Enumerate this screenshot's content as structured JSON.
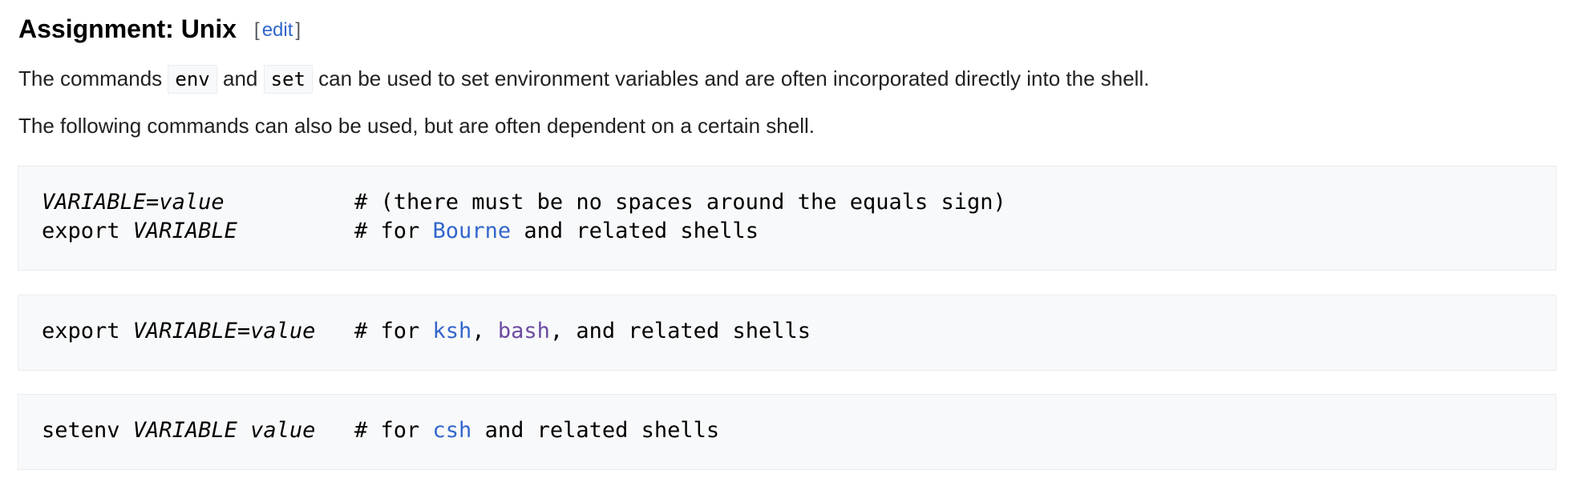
{
  "section": {
    "title": "Assignment: Unix",
    "edit_open": "[",
    "edit_label": "edit",
    "edit_close": "]"
  },
  "paragraph1": {
    "t1": "The commands ",
    "code1": "env",
    "t2": " and ",
    "code2": "set",
    "t3": " can be used to set environment variables and are often incorporated directly into the shell."
  },
  "paragraph2": {
    "text": "The following commands can also be used, but are often dependent on a certain shell."
  },
  "code_blocks": [
    {
      "lines": [
        {
          "cmd": [
            {
              "text": "VARIABLE",
              "italic": true
            },
            {
              "text": "=",
              "italic": false
            },
            {
              "text": "value",
              "italic": true
            }
          ],
          "comment": "# (there must be no spaces around the equals sign)"
        },
        {
          "cmd": [
            {
              "text": "export ",
              "italic": false
            },
            {
              "text": "VARIABLE",
              "italic": true
            }
          ],
          "comment_prefix": "# for ",
          "link": "Bourne",
          "comment_suffix": " and related shells"
        }
      ]
    },
    {
      "lines": [
        {
          "cmd": [
            {
              "text": "export ",
              "italic": false
            },
            {
              "text": "VARIABLE",
              "italic": true
            },
            {
              "text": "=",
              "italic": false
            },
            {
              "text": "value",
              "italic": true
            }
          ],
          "comment_prefix": "# for ",
          "link1": "ksh",
          "sep": ", ",
          "link2": "bash",
          "comment_suffix": ", and related shells"
        }
      ]
    },
    {
      "lines": [
        {
          "cmd": [
            {
              "text": "setenv ",
              "italic": false
            },
            {
              "text": "VARIABLE",
              "italic": true
            },
            {
              "text": " ",
              "italic": false
            },
            {
              "text": "value",
              "italic": true
            }
          ],
          "comment_prefix": "# for ",
          "link": "csh",
          "comment_suffix": " and related shells"
        }
      ]
    }
  ],
  "colors": {
    "link": "#3366cc",
    "visited_link": "#6b4ba1",
    "code_background": "#f8f9fa",
    "code_border": "#eaecf0",
    "body_text": "#202122"
  }
}
